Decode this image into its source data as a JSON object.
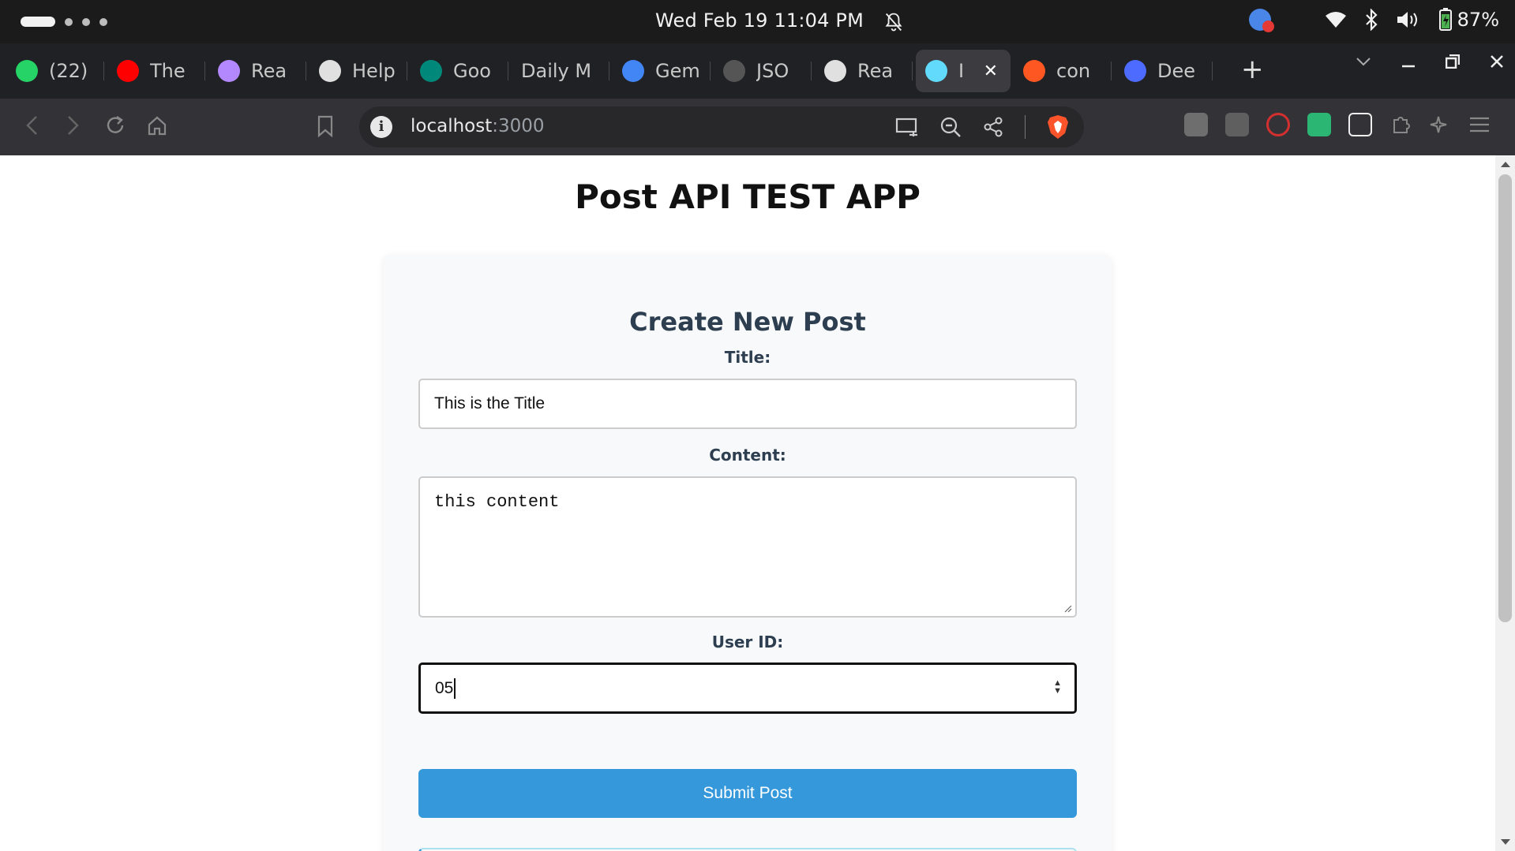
{
  "os_bar": {
    "clock": "Wed Feb 19  11:04 PM",
    "battery": "87%"
  },
  "tabs": [
    {
      "title": "(22)",
      "icon": "whatsapp-icon",
      "color": "#25d366"
    },
    {
      "title": "The",
      "icon": "youtube-icon",
      "color": "#ff0000"
    },
    {
      "title": "Rea",
      "icon": "avatar-icon",
      "color": "#b388ff"
    },
    {
      "title": "Help",
      "icon": "openai-icon",
      "color": "#e0e0e0"
    },
    {
      "title": "Goo",
      "icon": "google-meet-icon",
      "color": "#00897b"
    },
    {
      "title": "Daily M",
      "icon": "",
      "color": ""
    },
    {
      "title": "Gem",
      "icon": "gemini-icon",
      "color": "#4285f4"
    },
    {
      "title": "JSO",
      "icon": "json-icon",
      "color": "#555555"
    },
    {
      "title": "Rea",
      "icon": "openai-icon",
      "color": "#e0e0e0"
    },
    {
      "title": "I",
      "icon": "react-icon",
      "color": "#61dafb",
      "active": true
    },
    {
      "title": "con",
      "icon": "brave-shield-icon",
      "color": "#ff5722"
    },
    {
      "title": "Dee",
      "icon": "deepseek-icon",
      "color": "#4d6bfe"
    }
  ],
  "address_bar": {
    "host": "localhost",
    "port": ":3000"
  },
  "page": {
    "title": "Post API TEST APP",
    "form": {
      "heading": "Create New Post",
      "title_label": "Title:",
      "title_value": "This is the Title",
      "content_label": "Content:",
      "content_value": "this content",
      "userid_label": "User ID:",
      "userid_value": "05",
      "submit_label": "Submit Post"
    }
  },
  "colors": {
    "accent": "#3498db",
    "heading": "#2c3e50"
  }
}
